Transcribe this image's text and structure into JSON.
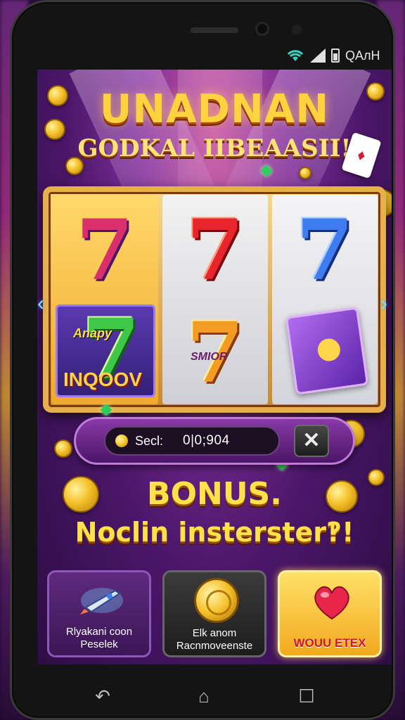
{
  "status_bar": {
    "text": "QAлH",
    "icons": [
      "wifi-icon",
      "signal-icon",
      "battery-icon"
    ]
  },
  "game": {
    "title": "UNADNAN",
    "subtitle": "GODKAL IIBEAASII!",
    "reels": {
      "top_row": [
        "7",
        "7",
        "7"
      ],
      "tile_small_label": "Anapy",
      "tile_big_label": "INQOOV",
      "gold_seven_label": "SMIOR"
    },
    "bet": {
      "label": "Secl:",
      "value": "0|0;904",
      "close_icon": "close-icon"
    },
    "bonus": {
      "title": "BONUS.",
      "subtitle": "Noclin insterster‽!"
    },
    "cards": [
      {
        "icon": "rocket-icon",
        "line1": "Rlyakani coon",
        "line2": "Peselek"
      },
      {
        "icon": "coin-icon",
        "line1": "Elk  anom",
        "line2": "Racnmoveenste"
      },
      {
        "icon": "heart-icon",
        "line1": "WOUU ETEX",
        "line2": ""
      }
    ],
    "colors": {
      "gold": "#ffd23f",
      "purple": "#4a1668",
      "highlight_card": "#f2a91f"
    }
  },
  "system_nav": {
    "icons": [
      "back-icon",
      "home-icon",
      "recents-icon"
    ]
  }
}
